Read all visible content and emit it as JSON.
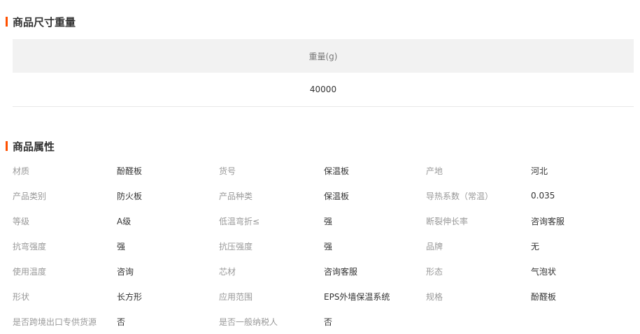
{
  "size_section": {
    "title": "商品尺寸重量",
    "header": "重量(g)",
    "value": "40000"
  },
  "attr_section": {
    "title": "商品属性",
    "rows": [
      [
        {
          "k": "材质",
          "v": "酚醛板"
        },
        {
          "k": "货号",
          "v": "保温板"
        },
        {
          "k": "产地",
          "v": "河北"
        }
      ],
      [
        {
          "k": "产品类别",
          "v": "防火板"
        },
        {
          "k": "产品种类",
          "v": "保温板"
        },
        {
          "k": "导热系数（常温）",
          "v": "0.035"
        }
      ],
      [
        {
          "k": "等级",
          "v": "A级"
        },
        {
          "k": "低温弯折≤",
          "v": "强"
        },
        {
          "k": "断裂伸长率",
          "v": "咨询客服"
        }
      ],
      [
        {
          "k": "抗弯强度",
          "v": "强"
        },
        {
          "k": "抗压强度",
          "v": "强"
        },
        {
          "k": "品牌",
          "v": "无"
        }
      ],
      [
        {
          "k": "使用温度",
          "v": "咨询"
        },
        {
          "k": "芯材",
          "v": "咨询客服"
        },
        {
          "k": "形态",
          "v": "气泡状"
        }
      ],
      [
        {
          "k": "形状",
          "v": "长方形"
        },
        {
          "k": "应用范围",
          "v": "EPS外墙保温系统"
        },
        {
          "k": "规格",
          "v": "酚醛板"
        }
      ],
      [
        {
          "k": "是否跨境出口专供货源",
          "v": "否"
        },
        {
          "k": "是否一般纳税人",
          "v": "否"
        },
        {
          "k": "",
          "v": ""
        }
      ]
    ]
  },
  "colors": {
    "accent": "#ff5000",
    "header_bg": "#f2f2f2",
    "key_text": "#999999",
    "value_text": "#333333"
  }
}
